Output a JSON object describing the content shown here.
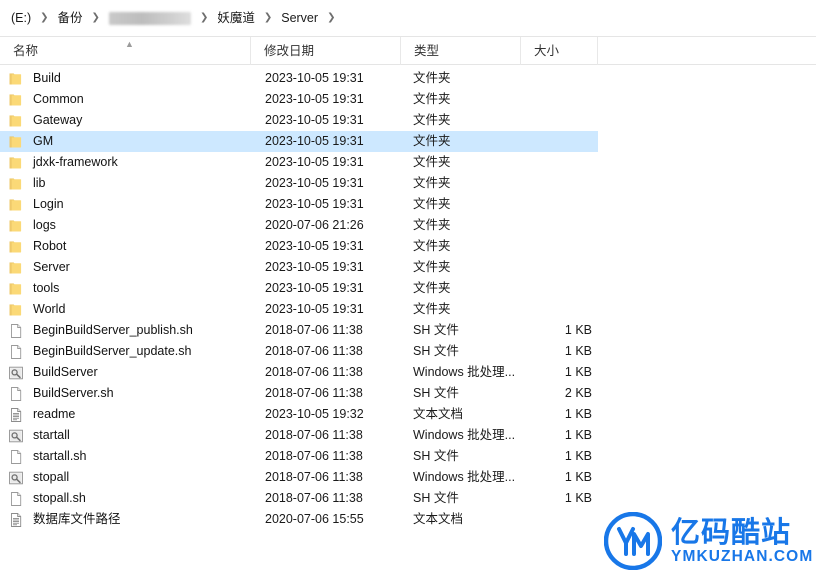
{
  "breadcrumb": {
    "items": [
      {
        "label": "(E:)",
        "redacted": false
      },
      {
        "label": "备份",
        "redacted": false
      },
      {
        "label": "",
        "redacted": true
      },
      {
        "label": "妖魔道",
        "redacted": false
      },
      {
        "label": "Server",
        "redacted": false
      }
    ],
    "separator": "❯"
  },
  "columns": {
    "name": "名称",
    "date": "修改日期",
    "type": "类型",
    "size": "大小",
    "sort_caret": "▲"
  },
  "rows": [
    {
      "name": "Build",
      "date": "2023-10-05 19:31",
      "type": "文件夹",
      "size": "",
      "icon": "folder-icon",
      "selected": false
    },
    {
      "name": "Common",
      "date": "2023-10-05 19:31",
      "type": "文件夹",
      "size": "",
      "icon": "folder-icon",
      "selected": false
    },
    {
      "name": "Gateway",
      "date": "2023-10-05 19:31",
      "type": "文件夹",
      "size": "",
      "icon": "folder-icon",
      "selected": false
    },
    {
      "name": "GM",
      "date": "2023-10-05 19:31",
      "type": "文件夹",
      "size": "",
      "icon": "folder-icon",
      "selected": true
    },
    {
      "name": "jdxk-framework",
      "date": "2023-10-05 19:31",
      "type": "文件夹",
      "size": "",
      "icon": "folder-icon",
      "selected": false
    },
    {
      "name": "lib",
      "date": "2023-10-05 19:31",
      "type": "文件夹",
      "size": "",
      "icon": "folder-icon",
      "selected": false
    },
    {
      "name": "Login",
      "date": "2023-10-05 19:31",
      "type": "文件夹",
      "size": "",
      "icon": "folder-icon",
      "selected": false
    },
    {
      "name": "logs",
      "date": "2020-07-06 21:26",
      "type": "文件夹",
      "size": "",
      "icon": "folder-icon",
      "selected": false
    },
    {
      "name": "Robot",
      "date": "2023-10-05 19:31",
      "type": "文件夹",
      "size": "",
      "icon": "folder-icon",
      "selected": false
    },
    {
      "name": "Server",
      "date": "2023-10-05 19:31",
      "type": "文件夹",
      "size": "",
      "icon": "folder-icon",
      "selected": false
    },
    {
      "name": "tools",
      "date": "2023-10-05 19:31",
      "type": "文件夹",
      "size": "",
      "icon": "folder-icon",
      "selected": false
    },
    {
      "name": "World",
      "date": "2023-10-05 19:31",
      "type": "文件夹",
      "size": "",
      "icon": "folder-icon",
      "selected": false
    },
    {
      "name": "BeginBuildServer_publish.sh",
      "date": "2018-07-06 11:38",
      "type": "SH 文件",
      "size": "1 KB",
      "icon": "blank-document-icon",
      "selected": false
    },
    {
      "name": "BeginBuildServer_update.sh",
      "date": "2018-07-06 11:38",
      "type": "SH 文件",
      "size": "1 KB",
      "icon": "blank-document-icon",
      "selected": false
    },
    {
      "name": "BuildServer",
      "date": "2018-07-06 11:38",
      "type": "Windows 批处理...",
      "size": "1 KB",
      "icon": "batch-file-icon",
      "selected": false
    },
    {
      "name": "BuildServer.sh",
      "date": "2018-07-06 11:38",
      "type": "SH 文件",
      "size": "2 KB",
      "icon": "blank-document-icon",
      "selected": false
    },
    {
      "name": "readme",
      "date": "2023-10-05 19:32",
      "type": "文本文档",
      "size": "1 KB",
      "icon": "text-document-icon",
      "selected": false
    },
    {
      "name": "startall",
      "date": "2018-07-06 11:38",
      "type": "Windows 批处理...",
      "size": "1 KB",
      "icon": "batch-file-icon",
      "selected": false
    },
    {
      "name": "startall.sh",
      "date": "2018-07-06 11:38",
      "type": "SH 文件",
      "size": "1 KB",
      "icon": "blank-document-icon",
      "selected": false
    },
    {
      "name": "stopall",
      "date": "2018-07-06 11:38",
      "type": "Windows 批处理...",
      "size": "1 KB",
      "icon": "batch-file-icon",
      "selected": false
    },
    {
      "name": "stopall.sh",
      "date": "2018-07-06 11:38",
      "type": "SH 文件",
      "size": "1 KB",
      "icon": "blank-document-icon",
      "selected": false
    },
    {
      "name": "数据库文件路径",
      "date": "2020-07-06 15:55",
      "type": "文本文档",
      "size": "",
      "icon": "text-document-icon",
      "selected": false
    }
  ],
  "watermark": {
    "cn": "亿码酷站",
    "en": "YMKUZHAN.COM",
    "mark": "YM",
    "color": "#1877e8"
  },
  "colors": {
    "selection": "#cde8ff",
    "folder": "#fbd977",
    "accent": "#1877e8"
  }
}
